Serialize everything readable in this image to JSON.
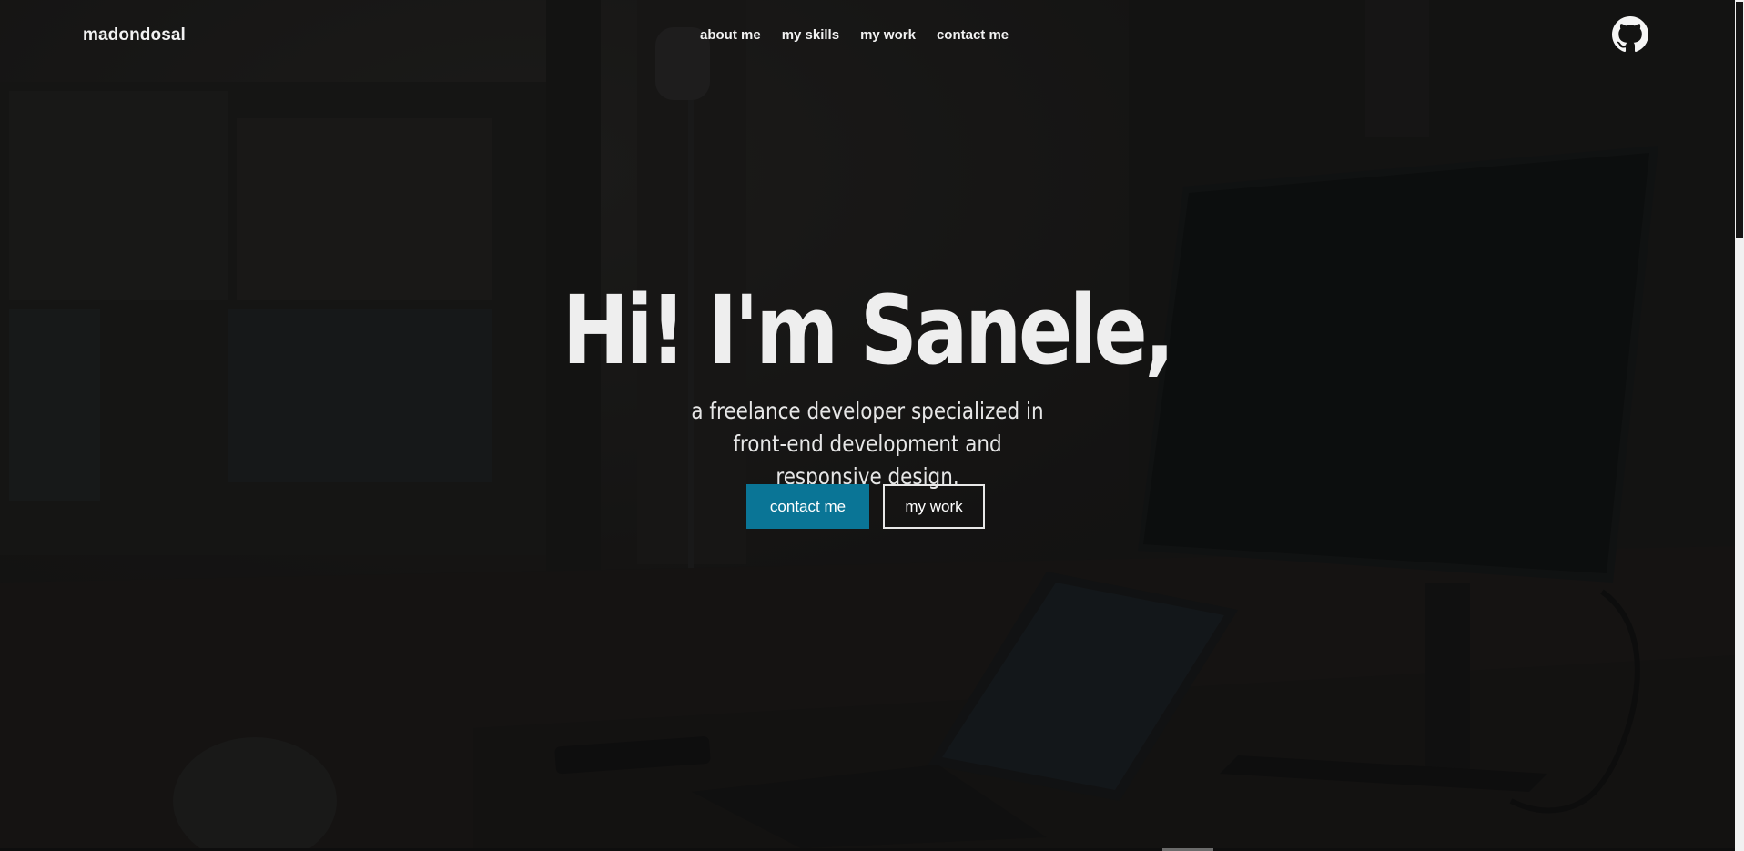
{
  "header": {
    "brand": "madondosal",
    "nav": [
      {
        "label": "about me"
      },
      {
        "label": "my skills"
      },
      {
        "label": "my work"
      },
      {
        "label": "contact me"
      }
    ],
    "github_icon": "github-icon"
  },
  "hero": {
    "title": "Hi! I'm Sanele,",
    "subtitle": "a freelance developer specialized in front-end development and responsive design.",
    "primary_button": "contact me",
    "secondary_button": "my work"
  },
  "colors": {
    "accent": "#0a7596",
    "background": "#171615",
    "text": "#f0f0f0"
  }
}
